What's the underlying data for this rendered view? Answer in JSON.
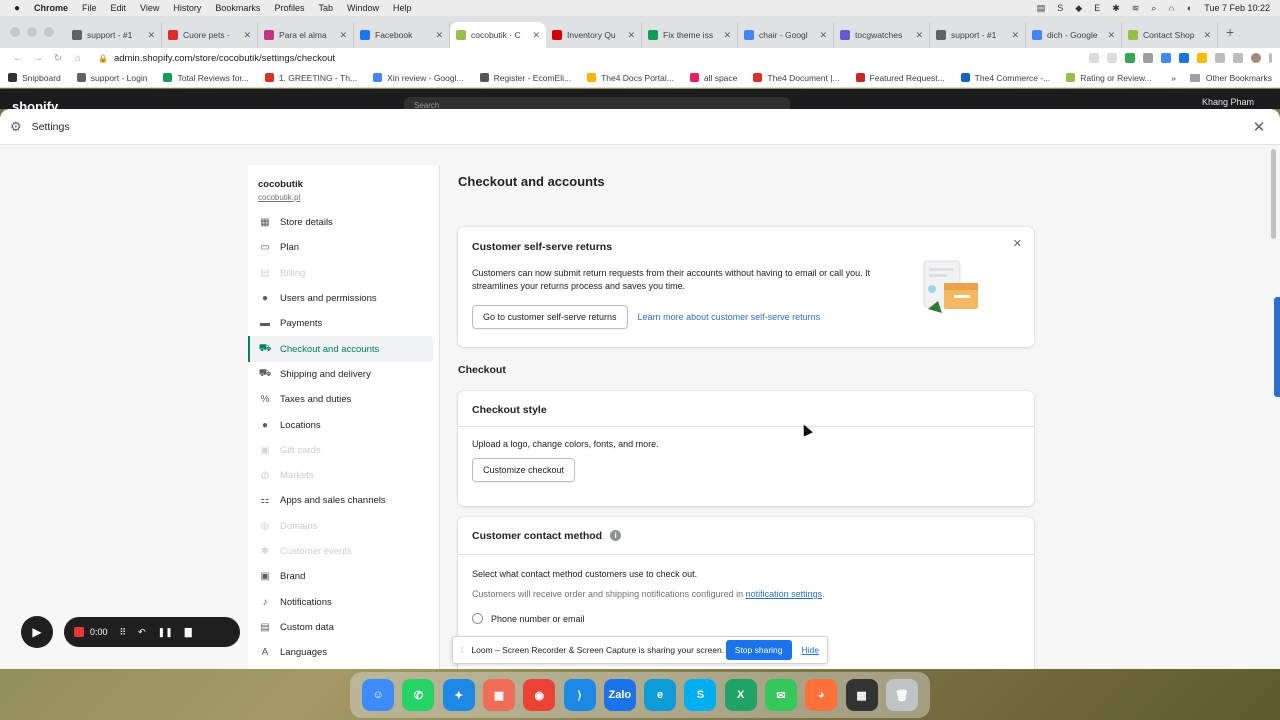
{
  "menubar": {
    "app": "Chrome",
    "items": [
      "File",
      "Edit",
      "View",
      "History",
      "Bookmarks",
      "Profiles",
      "Tab",
      "Window",
      "Help"
    ],
    "clock": "Tue 7 Feb  10:22"
  },
  "tabs": [
    {
      "title": "support - #1",
      "color": "#5f6368"
    },
    {
      "title": "Cuore pets -",
      "color": "#d93025"
    },
    {
      "title": "Para el alma",
      "color": "#c13584"
    },
    {
      "title": "Facebook",
      "color": "#1877f2"
    },
    {
      "title": "cocobutik · C",
      "color": "#95bf47",
      "active": true
    },
    {
      "title": "Inventory Qu",
      "color": "#d50000"
    },
    {
      "title": "Fix theme iss",
      "color": "#0f9d58"
    },
    {
      "title": "chair - Googl",
      "color": "#4285f4"
    },
    {
      "title": "tocgwatches",
      "color": "#6a5acd"
    },
    {
      "title": "support - #1",
      "color": "#5f6368"
    },
    {
      "title": "dich - Google",
      "color": "#4285f4"
    },
    {
      "title": "Contact Shop",
      "color": "#95bf47"
    }
  ],
  "address": {
    "url": "admin.shopify.com/store/cocobutik/settings/checkout"
  },
  "bookmarks": [
    {
      "label": "Snipboard",
      "color": "#333"
    },
    {
      "label": "support - Login",
      "color": "#5f6368"
    },
    {
      "label": "Total Reviews for...",
      "color": "#0f9d58"
    },
    {
      "label": "1. GREETING - Th...",
      "color": "#d93025"
    },
    {
      "label": "Xin review - Googl...",
      "color": "#4285f4"
    },
    {
      "label": "Register - EcomEli...",
      "color": "#555"
    },
    {
      "label": "The4 Docs Portal...",
      "color": "#f4b400"
    },
    {
      "label": "all space",
      "color": "#e91e63"
    },
    {
      "label": "The4 Document |...",
      "color": "#d93025"
    },
    {
      "label": "Featured Request...",
      "color": "#c62828"
    },
    {
      "label": "The4 Commerce -...",
      "color": "#1565c0"
    },
    {
      "label": "Rating or Review...",
      "color": "#95bf47"
    }
  ],
  "bookmarks_more": "»",
  "bookmarks_other": "Other Bookmarks",
  "shop_header": {
    "logo": "shopify",
    "search": "Search",
    "user": "Khang Pham"
  },
  "settings": {
    "title": "Settings"
  },
  "store": {
    "name": "cocobutik",
    "domain": "cocobutik.pl"
  },
  "nav": [
    {
      "label": "Store details",
      "icon": "store-icon",
      "glyph": "▦",
      "state": "normal"
    },
    {
      "label": "Plan",
      "icon": "plan-icon",
      "glyph": "▭",
      "state": "normal"
    },
    {
      "label": "Billing",
      "icon": "billing-icon",
      "glyph": "▤",
      "state": "disabled"
    },
    {
      "label": "Users and permissions",
      "icon": "user-icon",
      "glyph": "●",
      "state": "normal"
    },
    {
      "label": "Payments",
      "icon": "payments-icon",
      "glyph": "▬",
      "state": "normal"
    },
    {
      "label": "Checkout and accounts",
      "icon": "cart-icon",
      "glyph": "⛟",
      "state": "active"
    },
    {
      "label": "Shipping and delivery",
      "icon": "truck-icon",
      "glyph": "⛟",
      "state": "normal"
    },
    {
      "label": "Taxes and duties",
      "icon": "tax-icon",
      "glyph": "%",
      "state": "normal"
    },
    {
      "label": "Locations",
      "icon": "location-icon",
      "glyph": "●",
      "state": "normal"
    },
    {
      "label": "Gift cards",
      "icon": "gift-icon",
      "glyph": "▣",
      "state": "disabled"
    },
    {
      "label": "Markets",
      "icon": "globe-icon",
      "glyph": "◍",
      "state": "disabled"
    },
    {
      "label": "Apps and sales channels",
      "icon": "apps-icon",
      "glyph": "⚏",
      "state": "normal"
    },
    {
      "label": "Domains",
      "icon": "domain-icon",
      "glyph": "◍",
      "state": "disabled"
    },
    {
      "label": "Customer events",
      "icon": "events-icon",
      "glyph": "✱",
      "state": "disabled"
    },
    {
      "label": "Brand",
      "icon": "brand-icon",
      "glyph": "▣",
      "state": "normal"
    },
    {
      "label": "Notifications",
      "icon": "bell-icon",
      "glyph": "♪",
      "state": "normal"
    },
    {
      "label": "Custom data",
      "icon": "data-icon",
      "glyph": "▤",
      "state": "normal"
    },
    {
      "label": "Languages",
      "icon": "language-icon",
      "glyph": "A",
      "state": "normal"
    }
  ],
  "page": {
    "title": "Checkout and accounts"
  },
  "returns_card": {
    "title": "Customer self-serve returns",
    "body": "Customers can now submit return requests from their accounts without having to email or call you. It streamlines your returns process and saves you time.",
    "button": "Go to customer self-serve returns",
    "link": "Learn more about customer self-serve returns"
  },
  "checkout_section": {
    "title": "Checkout"
  },
  "style_card": {
    "title": "Checkout style",
    "body": "Upload a logo, change colors, fonts, and more.",
    "button": "Customize checkout"
  },
  "contact_card": {
    "title": "Customer contact method",
    "info_glyph": "i",
    "body": "Select what contact method customers use to check out.",
    "note_prefix": "Customers will receive order and shipping notifications configured in ",
    "note_link": "notification settings",
    "note_suffix": ".",
    "option1": "Phone number or email"
  },
  "loom": {
    "time": "0:00",
    "banner": "Loom – Screen Recorder & Screen Capture is sharing your screen.",
    "stop": "Stop sharing",
    "hide": "Hide"
  },
  "dock": [
    {
      "name": "finder",
      "color": "#3d8bfd",
      "glyph": "☺"
    },
    {
      "name": "whatsapp",
      "color": "#25d366",
      "glyph": "✆"
    },
    {
      "name": "safari",
      "color": "#1e88e5",
      "glyph": "✦"
    },
    {
      "name": "launchpad",
      "color": "#ef6c57",
      "glyph": "▦"
    },
    {
      "name": "chrome",
      "color": "#ea4335",
      "glyph": "◉"
    },
    {
      "name": "vscode",
      "color": "#1e88e5",
      "glyph": "⟩"
    },
    {
      "name": "zalo",
      "color": "#1a73e8",
      "glyph": "Zalo"
    },
    {
      "name": "edge",
      "color": "#0f9bd7",
      "glyph": "e"
    },
    {
      "name": "skype",
      "color": "#00aff0",
      "glyph": "S"
    },
    {
      "name": "spreadsheet",
      "color": "#21a366",
      "glyph": "X"
    },
    {
      "name": "messages",
      "color": "#34c759",
      "glyph": "✉"
    },
    {
      "name": "firefox",
      "color": "#ff7139",
      "glyph": "◕"
    },
    {
      "name": "calculator",
      "color": "#333333",
      "glyph": "▦"
    },
    {
      "name": "trash",
      "color": "#bfc3c6",
      "glyph": "🗑"
    }
  ]
}
